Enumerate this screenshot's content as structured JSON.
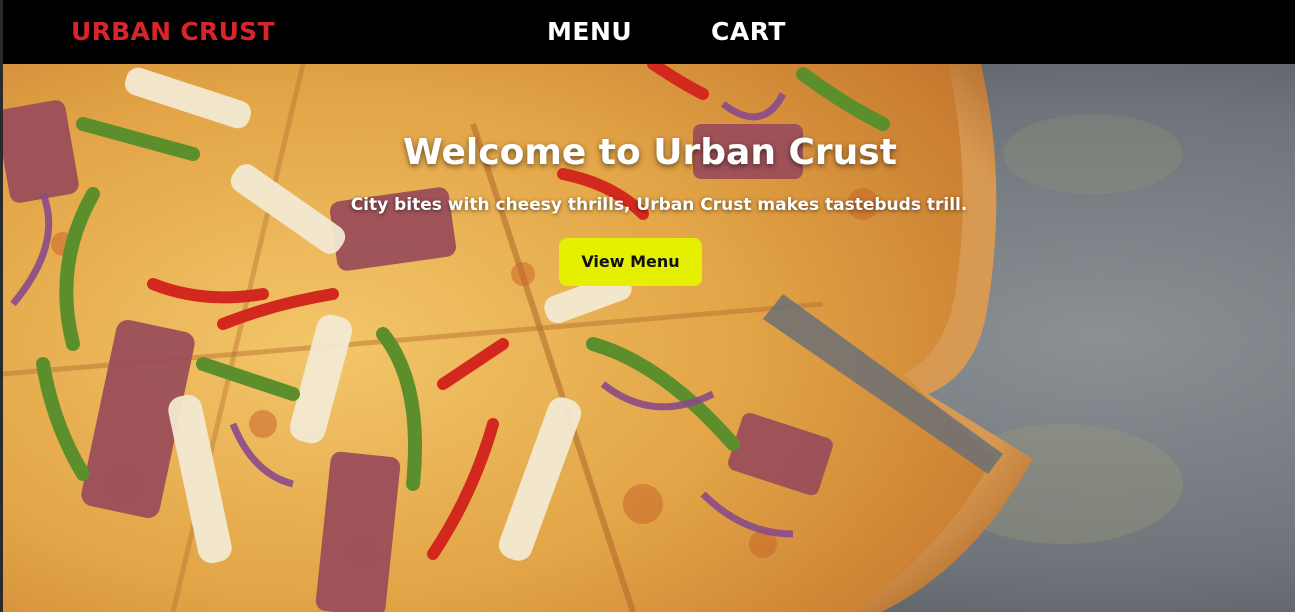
{
  "header": {
    "brand": "URBAN CRUST",
    "nav": {
      "menu": "MENU",
      "cart": "CART"
    }
  },
  "hero": {
    "title": "Welcome to Urban Crust",
    "subtitle": "City bites with cheesy thrills, Urban Crust makes tastebuds trill.",
    "cta_label": "View Menu"
  },
  "colors": {
    "brand_red": "#d7262b",
    "cta_yellow": "#e5f000",
    "nav_bg": "#000000"
  }
}
